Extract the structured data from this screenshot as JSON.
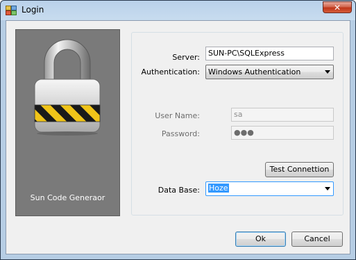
{
  "window": {
    "title": "Login",
    "close_glyph": "✕"
  },
  "logo_panel": {
    "caption": "Sun Code Generaor"
  },
  "form": {
    "server_label": "Server:",
    "server_value": "SUN-PC\\SQLExpress",
    "auth_label": "Authentication:",
    "auth_value": "Windows Authentication",
    "username_label": "User Name:",
    "username_value": "sa",
    "password_label": "Password:",
    "password_value": "●●●",
    "test_button": "Test Connettion",
    "database_label": "Data Base:",
    "database_value": "Hoze"
  },
  "buttons": {
    "ok": "Ok",
    "cancel": "Cancel"
  },
  "colors": {
    "logo_panel_bg": "#7a7a7a",
    "selection": "#3399ff",
    "close_button": "#c0361a"
  }
}
